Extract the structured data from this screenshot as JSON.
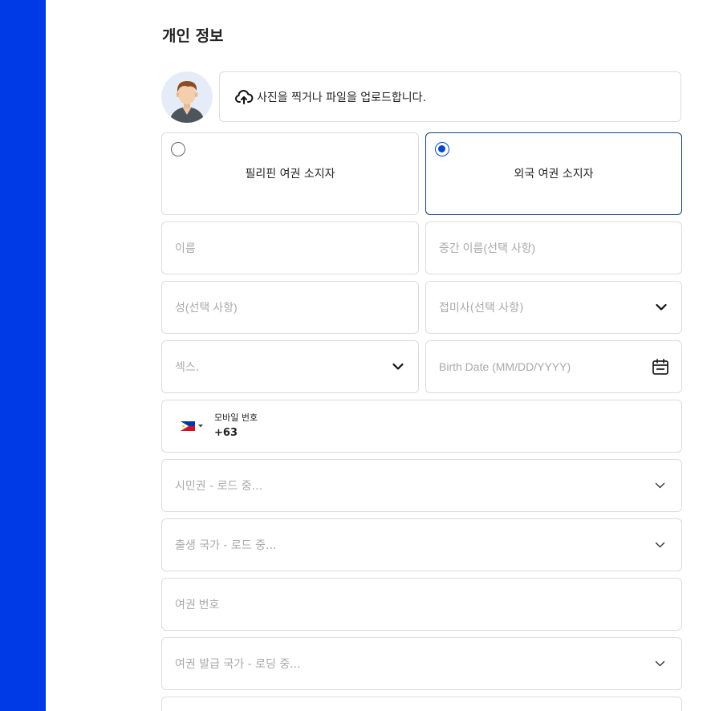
{
  "page": {
    "title": "개인 정보"
  },
  "photo": {
    "upload_label": "사진을 찍거나 파일을 업로드합니다."
  },
  "passport_type": {
    "options": [
      {
        "label": "필리핀 여권 소지자",
        "selected": false
      },
      {
        "label": "외국 여권 소지자",
        "selected": true
      }
    ]
  },
  "form": {
    "first_name_placeholder": "이름",
    "middle_name_placeholder": "중간 이름(선택 사항)",
    "last_name_placeholder": "성(선택 사항)",
    "suffix_placeholder": "접미사(선택 사항)",
    "sex_placeholder": "섹스.",
    "birth_date_placeholder": "Birth Date (MM/DD/YYYY)",
    "mobile_label": "모바일 번호",
    "mobile_code": "+63",
    "citizenship_placeholder": "시민권 - 로드 중...",
    "birth_country_placeholder": "출생 국가 - 로드 중...",
    "passport_number_placeholder": "여권 번호",
    "passport_issuing_country_placeholder": "여권 발급 국가 - 로딩 중..."
  },
  "colors": {
    "sidebar": "#0039e6",
    "radio_selected": "#0b49c9",
    "selected_border": "#0d3c7a"
  },
  "icons": {
    "upload": "cloud-upload-icon",
    "calendar": "calendar-icon",
    "chevron": "chevron-down-icon",
    "flag": "philippines-flag-icon"
  }
}
